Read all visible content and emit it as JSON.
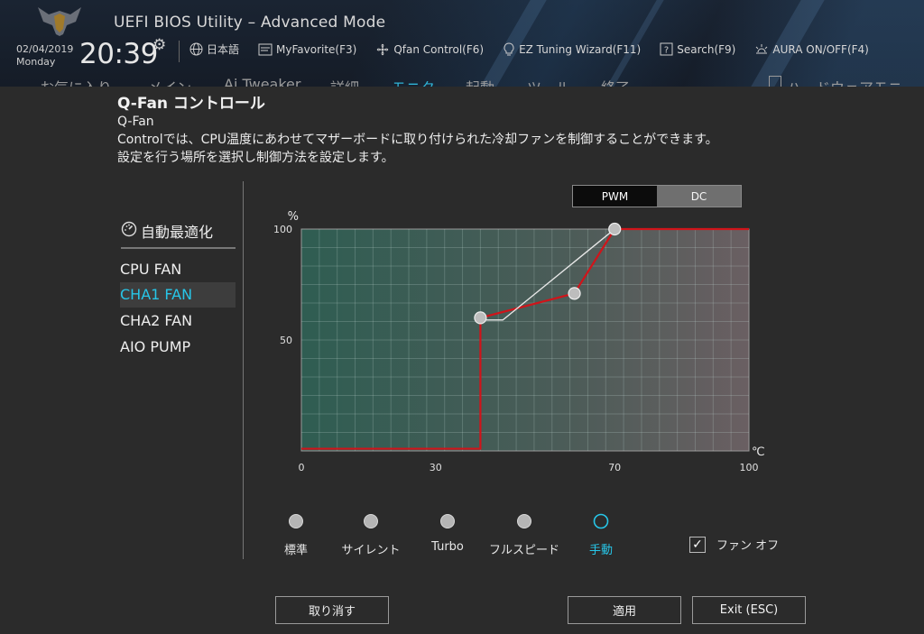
{
  "header": {
    "title": "UEFI BIOS Utility – Advanced Mode",
    "date": "02/04/2019",
    "day": "Monday",
    "time": "20:39",
    "toolbar": [
      {
        "icon": "globe-icon",
        "label": "日本語"
      },
      {
        "icon": "favorite-icon",
        "label": "MyFavorite(F3)"
      },
      {
        "icon": "fan-icon",
        "label": "Qfan Control(F6)"
      },
      {
        "icon": "bulb-icon",
        "label": "EZ Tuning Wizard(F11)"
      },
      {
        "icon": "search-icon",
        "label": "Search(F9)"
      },
      {
        "icon": "aura-icon",
        "label": "AURA ON/OFF(F4)"
      }
    ],
    "menu": [
      {
        "label": "お気に入り",
        "active": false
      },
      {
        "label": "メイン",
        "active": false
      },
      {
        "label": "Ai Tweaker",
        "active": false
      },
      {
        "label": "詳細",
        "active": false
      },
      {
        "label": "モニタ",
        "active": true
      },
      {
        "label": "起動",
        "active": false
      },
      {
        "label": "ツール",
        "active": false
      },
      {
        "label": "終了",
        "active": false
      }
    ],
    "hw_monitor": "ハードウェアモニ"
  },
  "dialog": {
    "title": "Q-Fan コントロール",
    "desc_line1": "Q-Fan",
    "desc_line2": "Controlでは、CPU温度にあわせてマザーボードに取り付けられた冷却ファンを制御することができます。",
    "desc_line3": "設定を行う場所を選択し制御方法を設定します。"
  },
  "mode": {
    "pwm": "PWM",
    "dc": "DC",
    "selected": "PWM"
  },
  "left_panel": {
    "auto_optimize": "自動最適化",
    "fans": [
      {
        "label": "CPU FAN",
        "selected": false
      },
      {
        "label": "CHA1 FAN",
        "selected": true
      },
      {
        "label": "CHA2 FAN",
        "selected": false
      },
      {
        "label": "AIO PUMP",
        "selected": false
      }
    ]
  },
  "chart_data": {
    "type": "line",
    "ylabel": "%",
    "xlabel": "℃",
    "xlim": [
      0,
      100
    ],
    "ylim": [
      0,
      100
    ],
    "x_ticks": [
      0,
      30,
      70,
      100
    ],
    "y_ticks": [
      50,
      100
    ],
    "grid": true,
    "series": [
      {
        "role": "fan-curve",
        "color": "#d0141a",
        "x": [
          0,
          40,
          40,
          61,
          70,
          100
        ],
        "y": [
          1,
          1,
          60,
          71,
          100,
          100
        ]
      },
      {
        "role": "actual",
        "color": "#e8e8e8",
        "x": [
          40,
          45,
          70
        ],
        "y": [
          59,
          59,
          100
        ]
      }
    ],
    "control_points": [
      {
        "x": 40,
        "y": 60
      },
      {
        "x": 61,
        "y": 71
      },
      {
        "x": 70,
        "y": 100
      }
    ]
  },
  "presets": {
    "items": [
      "標準",
      "サイレント",
      "Turbo",
      "フルスピード",
      "手動"
    ],
    "selected_index": 4
  },
  "fan_off": {
    "label": "ファン オフ",
    "checked": true
  },
  "buttons": {
    "cancel": "取り消す",
    "apply": "適用",
    "exit": "Exit (ESC)"
  },
  "colors": {
    "accent": "#27c6e8",
    "curve": "#d0141a"
  }
}
